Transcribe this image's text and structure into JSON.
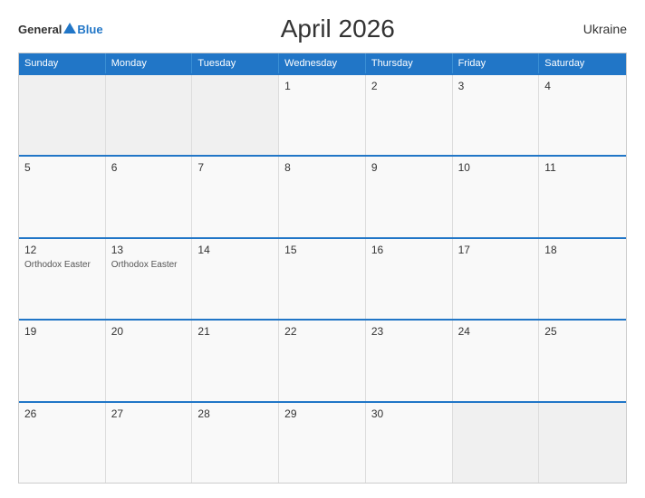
{
  "header": {
    "title": "April 2026",
    "country": "Ukraine",
    "logo_general": "General",
    "logo_blue": "Blue"
  },
  "calendar": {
    "days_of_week": [
      "Sunday",
      "Monday",
      "Tuesday",
      "Wednesday",
      "Thursday",
      "Friday",
      "Saturday"
    ],
    "weeks": [
      [
        {
          "day": "",
          "empty": true
        },
        {
          "day": "",
          "empty": true
        },
        {
          "day": "1",
          "empty": false,
          "event": ""
        },
        {
          "day": "2",
          "empty": false,
          "event": ""
        },
        {
          "day": "3",
          "empty": false,
          "event": ""
        },
        {
          "day": "4",
          "empty": false,
          "event": ""
        }
      ],
      [
        {
          "day": "5",
          "empty": false,
          "event": ""
        },
        {
          "day": "6",
          "empty": false,
          "event": ""
        },
        {
          "day": "7",
          "empty": false,
          "event": ""
        },
        {
          "day": "8",
          "empty": false,
          "event": ""
        },
        {
          "day": "9",
          "empty": false,
          "event": ""
        },
        {
          "day": "10",
          "empty": false,
          "event": ""
        },
        {
          "day": "11",
          "empty": false,
          "event": ""
        }
      ],
      [
        {
          "day": "12",
          "empty": false,
          "event": "Orthodox Easter"
        },
        {
          "day": "13",
          "empty": false,
          "event": "Orthodox Easter"
        },
        {
          "day": "14",
          "empty": false,
          "event": ""
        },
        {
          "day": "15",
          "empty": false,
          "event": ""
        },
        {
          "day": "16",
          "empty": false,
          "event": ""
        },
        {
          "day": "17",
          "empty": false,
          "event": ""
        },
        {
          "day": "18",
          "empty": false,
          "event": ""
        }
      ],
      [
        {
          "day": "19",
          "empty": false,
          "event": ""
        },
        {
          "day": "20",
          "empty": false,
          "event": ""
        },
        {
          "day": "21",
          "empty": false,
          "event": ""
        },
        {
          "day": "22",
          "empty": false,
          "event": ""
        },
        {
          "day": "23",
          "empty": false,
          "event": ""
        },
        {
          "day": "24",
          "empty": false,
          "event": ""
        },
        {
          "day": "25",
          "empty": false,
          "event": ""
        }
      ],
      [
        {
          "day": "26",
          "empty": false,
          "event": ""
        },
        {
          "day": "27",
          "empty": false,
          "event": ""
        },
        {
          "day": "28",
          "empty": false,
          "event": ""
        },
        {
          "day": "29",
          "empty": false,
          "event": ""
        },
        {
          "day": "30",
          "empty": false,
          "event": ""
        },
        {
          "day": "",
          "empty": true
        },
        {
          "day": "",
          "empty": true
        }
      ]
    ]
  }
}
